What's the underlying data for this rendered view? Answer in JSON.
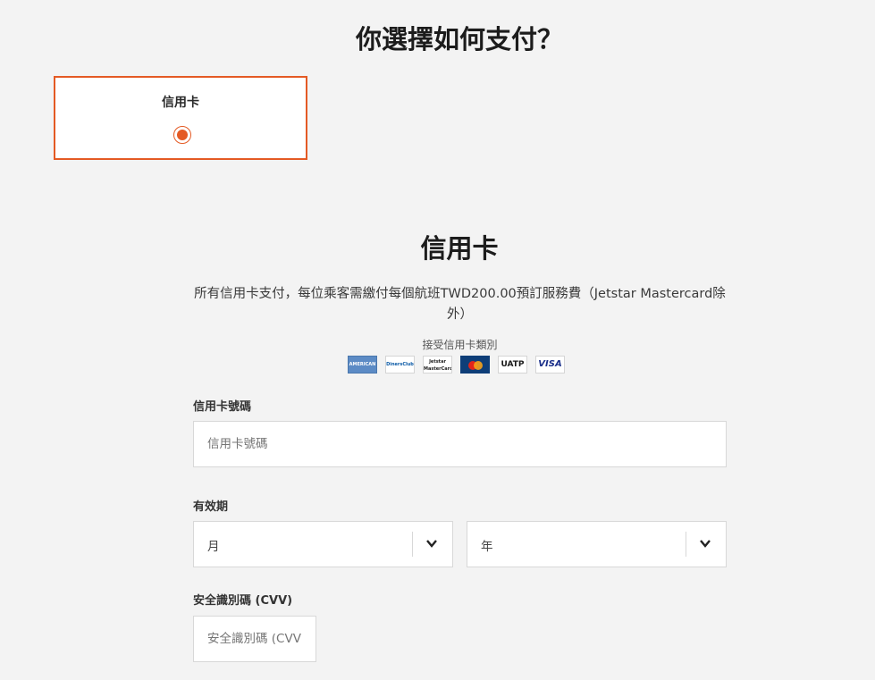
{
  "header": {
    "title": "你選擇如何支付？"
  },
  "payment_options": [
    {
      "label": "信用卡",
      "selected": true
    }
  ],
  "credit_card": {
    "title": "信用卡",
    "fee_note": "所有信用卡支付，每位乘客需繳付每個航班TWD200.00預訂服務費（Jetstar Mastercard除外）",
    "accepted_label": "接受信用卡類別",
    "card_logos": [
      {
        "name": "American Express",
        "icon": "amex-icon",
        "text": "AMERICAN EXPRESS"
      },
      {
        "name": "Diners Club",
        "icon": "diners-club-icon",
        "text": "DinersClub"
      },
      {
        "name": "Jetstar MasterCard",
        "icon": "jetstar-mastercard-icon",
        "text": "Jetstar MasterCard"
      },
      {
        "name": "MasterCard",
        "icon": "mastercard-icon",
        "text": ""
      },
      {
        "name": "UATP",
        "icon": "uatp-icon",
        "text": "UATP"
      },
      {
        "name": "VISA",
        "icon": "visa-icon",
        "text": "VISA"
      }
    ],
    "card_number": {
      "label": "信用卡號碼",
      "placeholder": "信用卡號碼",
      "value": ""
    },
    "expiry": {
      "label": "有效期",
      "month": {
        "selected": "月"
      },
      "year": {
        "selected": "年"
      }
    },
    "cvv": {
      "label": "安全識別碼 (CVV)",
      "placeholder": "安全識別碼 (CVV)",
      "value": ""
    }
  },
  "colors": {
    "accent": "#e45a24",
    "background": "#f3f3f3",
    "border": "#d8d8d8"
  }
}
